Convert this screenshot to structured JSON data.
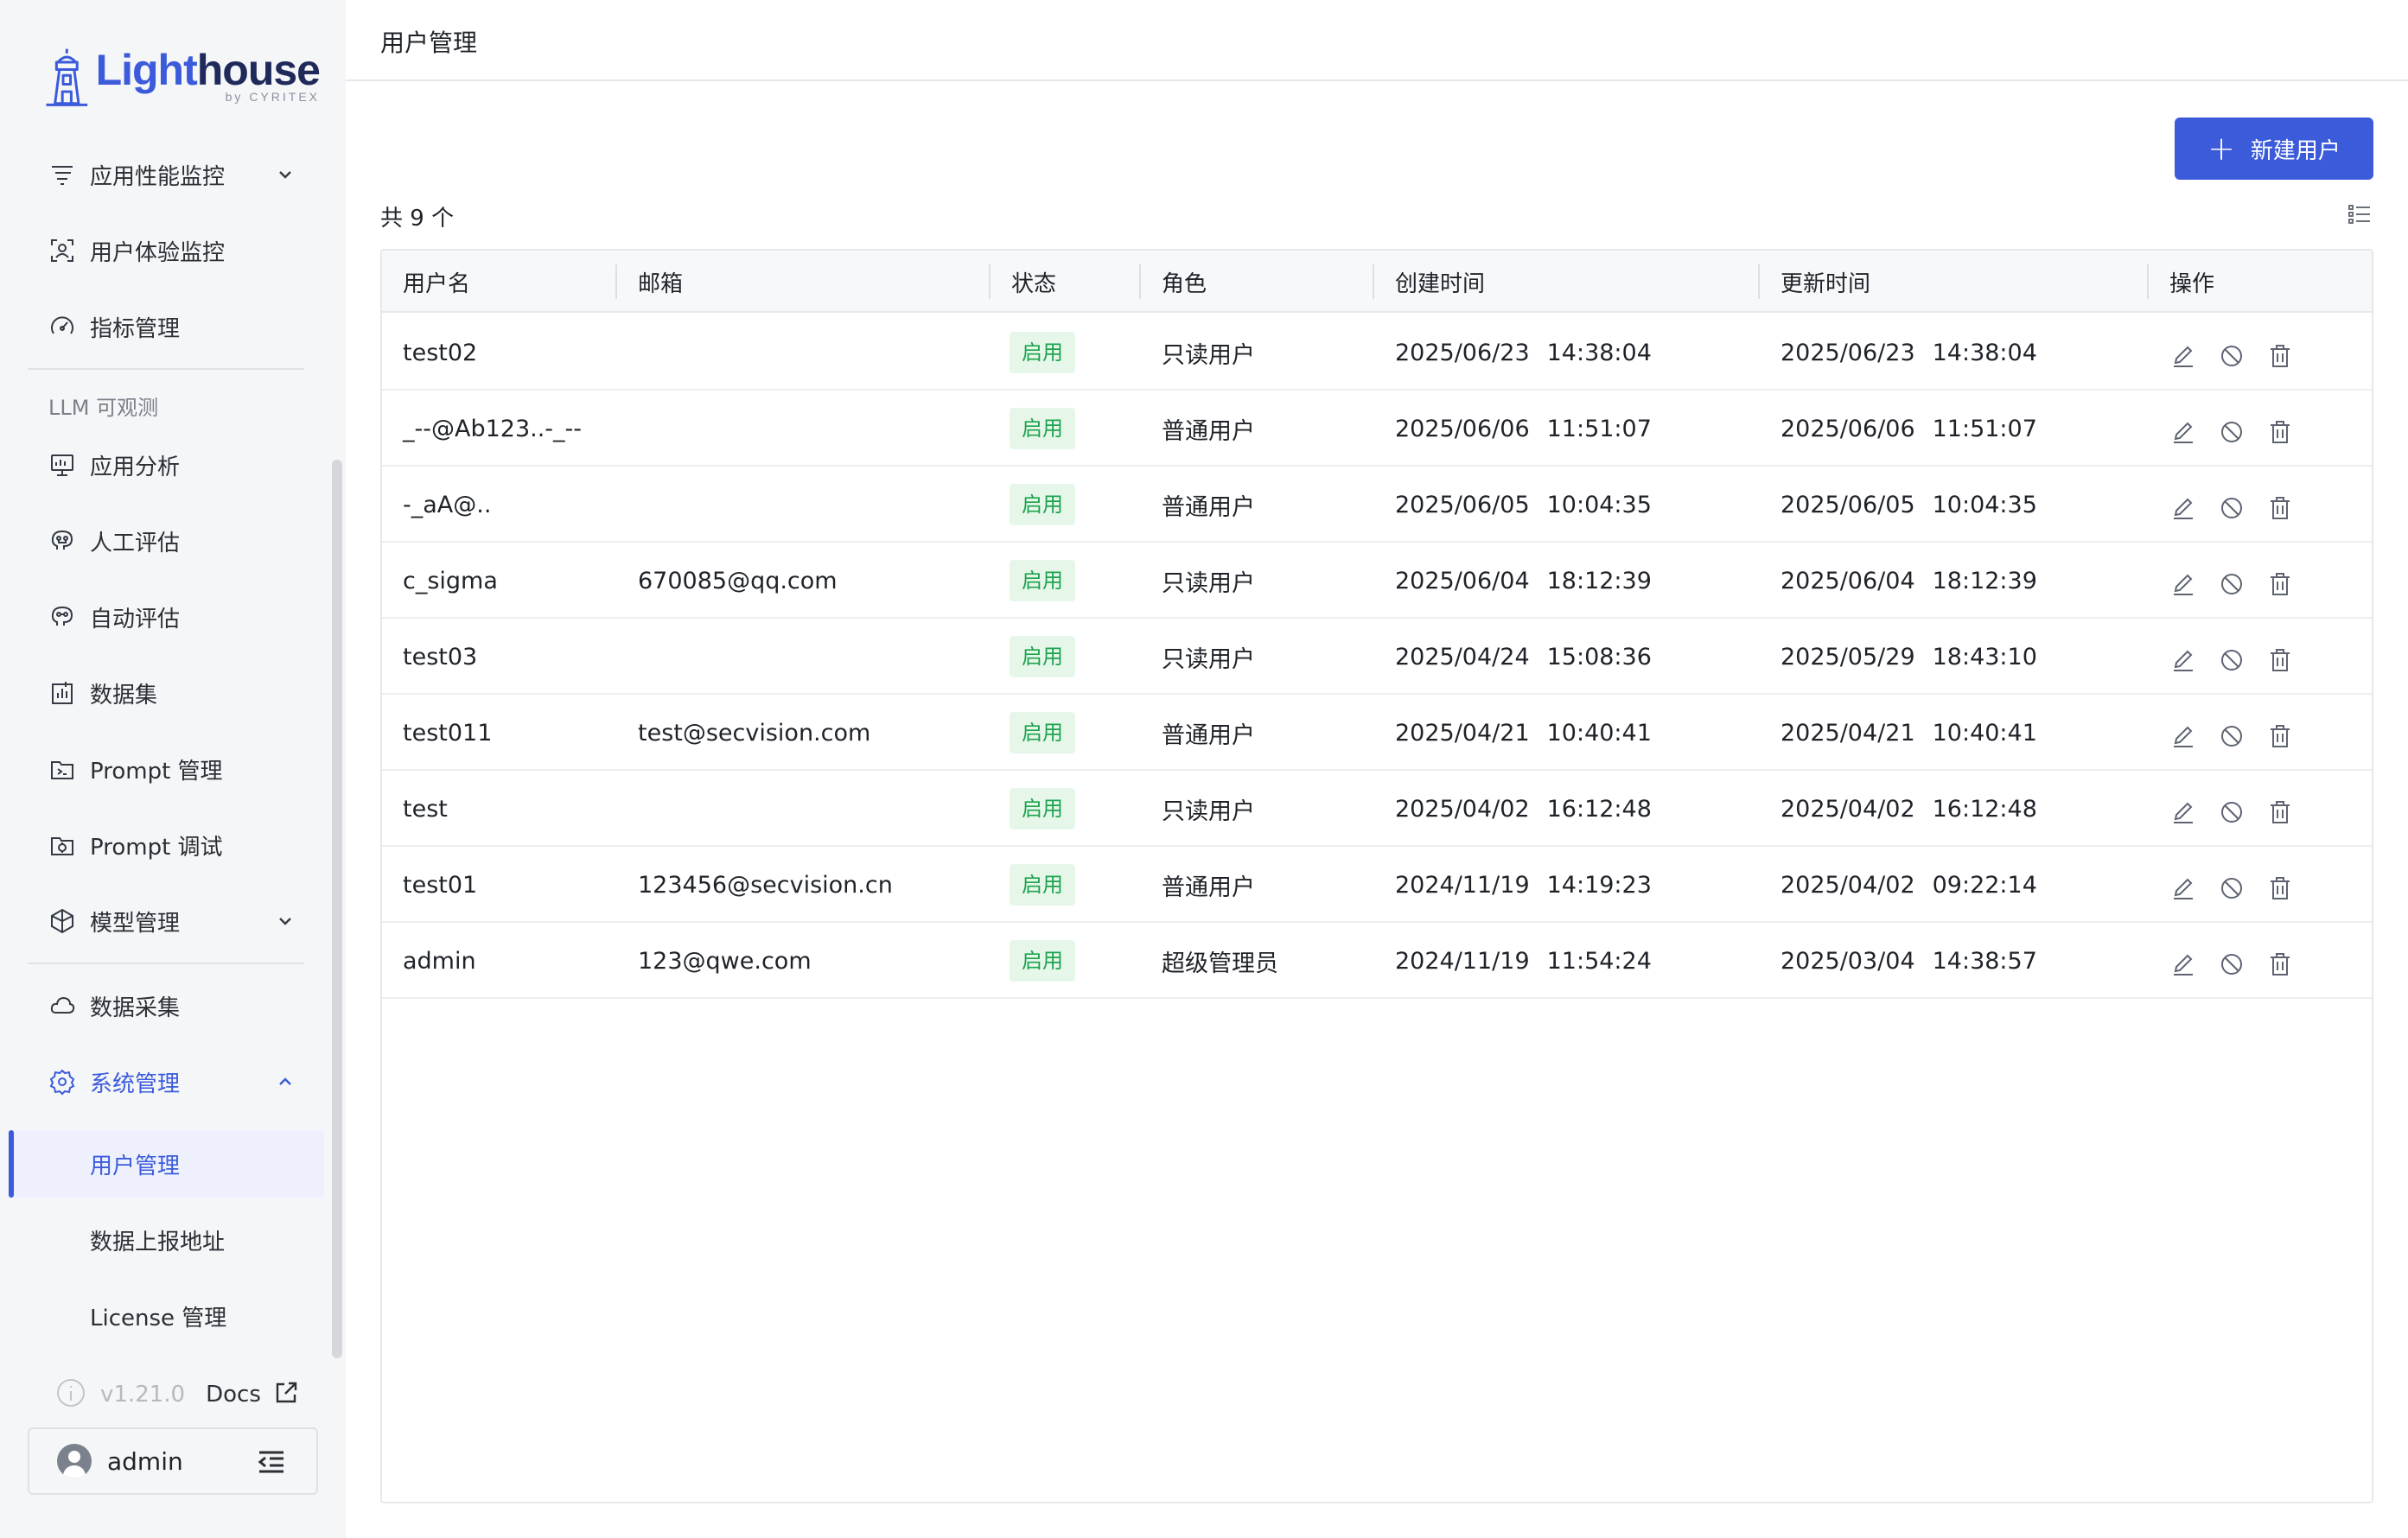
{
  "brand": {
    "name_part1": "Light",
    "name_part2": "house",
    "byline": "by CYRITEX"
  },
  "sidebar": {
    "items": [
      {
        "label": "应用性能监控",
        "icon": "apm-icon",
        "expandable": true
      },
      {
        "label": "用户体验监控",
        "icon": "user-experience-icon",
        "expandable": false
      },
      {
        "label": "指标管理",
        "icon": "metrics-gauge-icon",
        "expandable": false
      }
    ],
    "llm_section_label": "LLM 可观测",
    "llm_items": [
      {
        "label": "应用分析",
        "icon": "monitor-icon"
      },
      {
        "label": "人工评估",
        "icon": "brain-icon"
      },
      {
        "label": "自动评估",
        "icon": "brain-auto-icon"
      },
      {
        "label": "数据集",
        "icon": "bar-chart-icon"
      },
      {
        "label": "Prompt 管理",
        "icon": "prompt-folder-icon"
      },
      {
        "label": "Prompt 调试",
        "icon": "prompt-debug-icon"
      },
      {
        "label": "模型管理",
        "icon": "model-cube-icon",
        "expandable": true
      }
    ],
    "data_collection": {
      "label": "数据采集",
      "icon": "cloud-icon"
    },
    "system": {
      "label": "系统管理",
      "icon": "gear-icon",
      "expanded": true
    },
    "system_sub": [
      {
        "label": "用户管理",
        "selected": true
      },
      {
        "label": "数据上报地址",
        "selected": false
      },
      {
        "label": "License 管理",
        "selected": false
      }
    ],
    "version": "v1.21.0",
    "docs_label": "Docs",
    "user": "admin"
  },
  "header": {
    "title": "用户管理"
  },
  "toolbar": {
    "new_user_label": "新建用户",
    "count_text": "共 9 个"
  },
  "table": {
    "columns": [
      "用户名",
      "邮箱",
      "状态",
      "角色",
      "创建时间",
      "更新时间",
      "操作"
    ],
    "rows": [
      {
        "username": "test02",
        "email": "",
        "status": "启用",
        "role": "只读用户",
        "created_date": "2025/06/23",
        "created_time": "14:38:04",
        "updated_date": "2025/06/23",
        "updated_time": "14:38:04"
      },
      {
        "username": "_--@Ab123..-_--",
        "email": "",
        "status": "启用",
        "role": "普通用户",
        "created_date": "2025/06/06",
        "created_time": "11:51:07",
        "updated_date": "2025/06/06",
        "updated_time": "11:51:07"
      },
      {
        "username": "-_aA@..",
        "email": "",
        "status": "启用",
        "role": "普通用户",
        "created_date": "2025/06/05",
        "created_time": "10:04:35",
        "updated_date": "2025/06/05",
        "updated_time": "10:04:35"
      },
      {
        "username": "c_sigma",
        "email": "670085@qq.com",
        "status": "启用",
        "role": "只读用户",
        "created_date": "2025/06/04",
        "created_time": "18:12:39",
        "updated_date": "2025/06/04",
        "updated_time": "18:12:39"
      },
      {
        "username": "test03",
        "email": "",
        "status": "启用",
        "role": "只读用户",
        "created_date": "2025/04/24",
        "created_time": "15:08:36",
        "updated_date": "2025/05/29",
        "updated_time": "18:43:10"
      },
      {
        "username": "test011",
        "email": "test@secvision.com",
        "status": "启用",
        "role": "普通用户",
        "created_date": "2025/04/21",
        "created_time": "10:40:41",
        "updated_date": "2025/04/21",
        "updated_time": "10:40:41"
      },
      {
        "username": "test",
        "email": "",
        "status": "启用",
        "role": "只读用户",
        "created_date": "2025/04/02",
        "created_time": "16:12:48",
        "updated_date": "2025/04/02",
        "updated_time": "16:12:48"
      },
      {
        "username": "test01",
        "email": "123456@secvision.cn",
        "status": "启用",
        "role": "普通用户",
        "created_date": "2024/11/19",
        "created_time": "14:19:23",
        "updated_date": "2025/04/02",
        "updated_time": "09:22:14"
      },
      {
        "username": "admin",
        "email": "123@qwe.com",
        "status": "启用",
        "role": "超级管理员",
        "created_date": "2024/11/19",
        "created_time": "11:54:24",
        "updated_date": "2025/03/04",
        "updated_time": "14:38:57"
      }
    ]
  },
  "colors": {
    "accent": "#3b5bdb",
    "status_enabled_bg": "#e6f7ea",
    "status_enabled_text": "#1ea34f"
  }
}
